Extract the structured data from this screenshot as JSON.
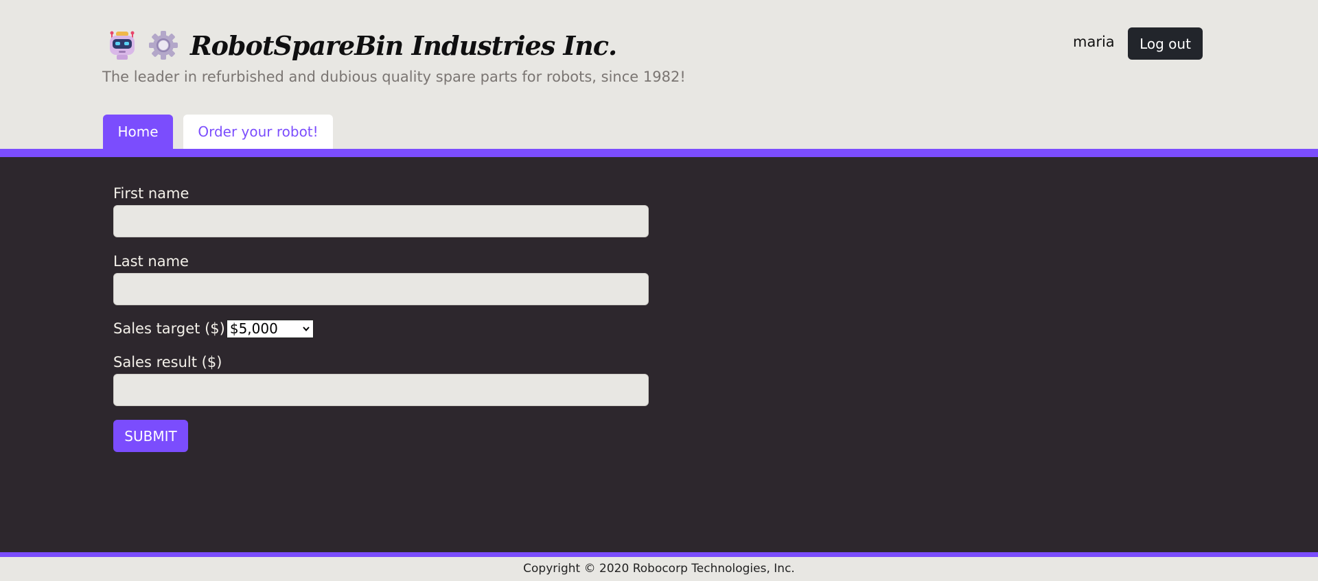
{
  "header": {
    "title": "RobotSpareBin Industries Inc.",
    "tagline": "The leader in refurbished and dubious quality spare parts for robots, since 1982!",
    "icons": [
      "robot-icon",
      "gear-icon"
    ]
  },
  "user": {
    "name": "maria",
    "logout_label": "Log out"
  },
  "tabs": [
    {
      "label": "Home",
      "active": true
    },
    {
      "label": "Order your robot!",
      "active": false
    }
  ],
  "form": {
    "first_name": {
      "label": "First name",
      "value": ""
    },
    "last_name": {
      "label": "Last name",
      "value": ""
    },
    "sales_target": {
      "label": "Sales target ($)",
      "selected": "$5,000"
    },
    "sales_result": {
      "label": "Sales result ($)",
      "value": ""
    },
    "submit_label": "SUBMIT"
  },
  "footer": {
    "copyright": "Copyright © 2020 Robocorp Technologies, Inc."
  },
  "colors": {
    "accent": "#7b4dfd",
    "main_bg": "#2d272d",
    "page_bg": "#e8e7e3",
    "logout_bg": "#22252b"
  }
}
